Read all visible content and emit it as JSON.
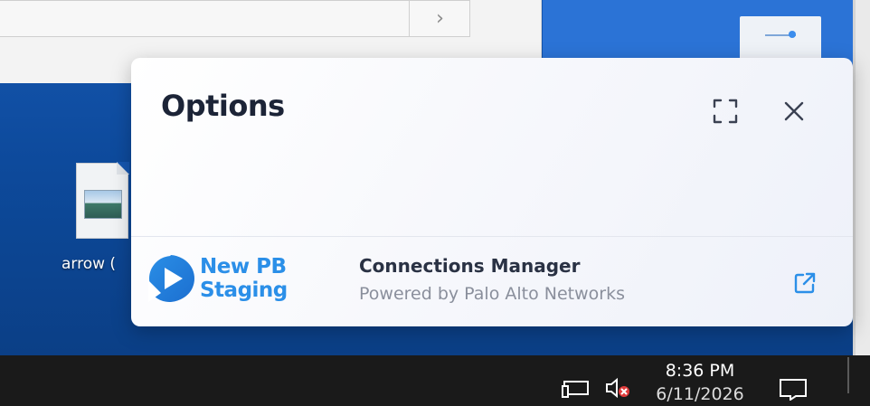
{
  "desktop": {
    "icon_label": "arrow (",
    "explorer_scroll_arrow": "›"
  },
  "panel": {
    "title": "Options",
    "app": {
      "brand_line1": "New PB",
      "brand_line2": "Staging",
      "title": "Connections Manager",
      "subtitle": "Powered by Palo Alto Networks"
    },
    "icons": {
      "expand": "expand-icon",
      "close": "close-icon",
      "external": "external-link-icon"
    }
  },
  "taskbar": {
    "time": "8:36 PM",
    "date": "6/11/2026"
  },
  "colors": {
    "brand_blue": "#2b8fe8",
    "title_text": "#1c2437",
    "muted_text": "#8a8f9c",
    "desktop_blue": "#1657b0",
    "taskbar": "#1a1a1a"
  }
}
